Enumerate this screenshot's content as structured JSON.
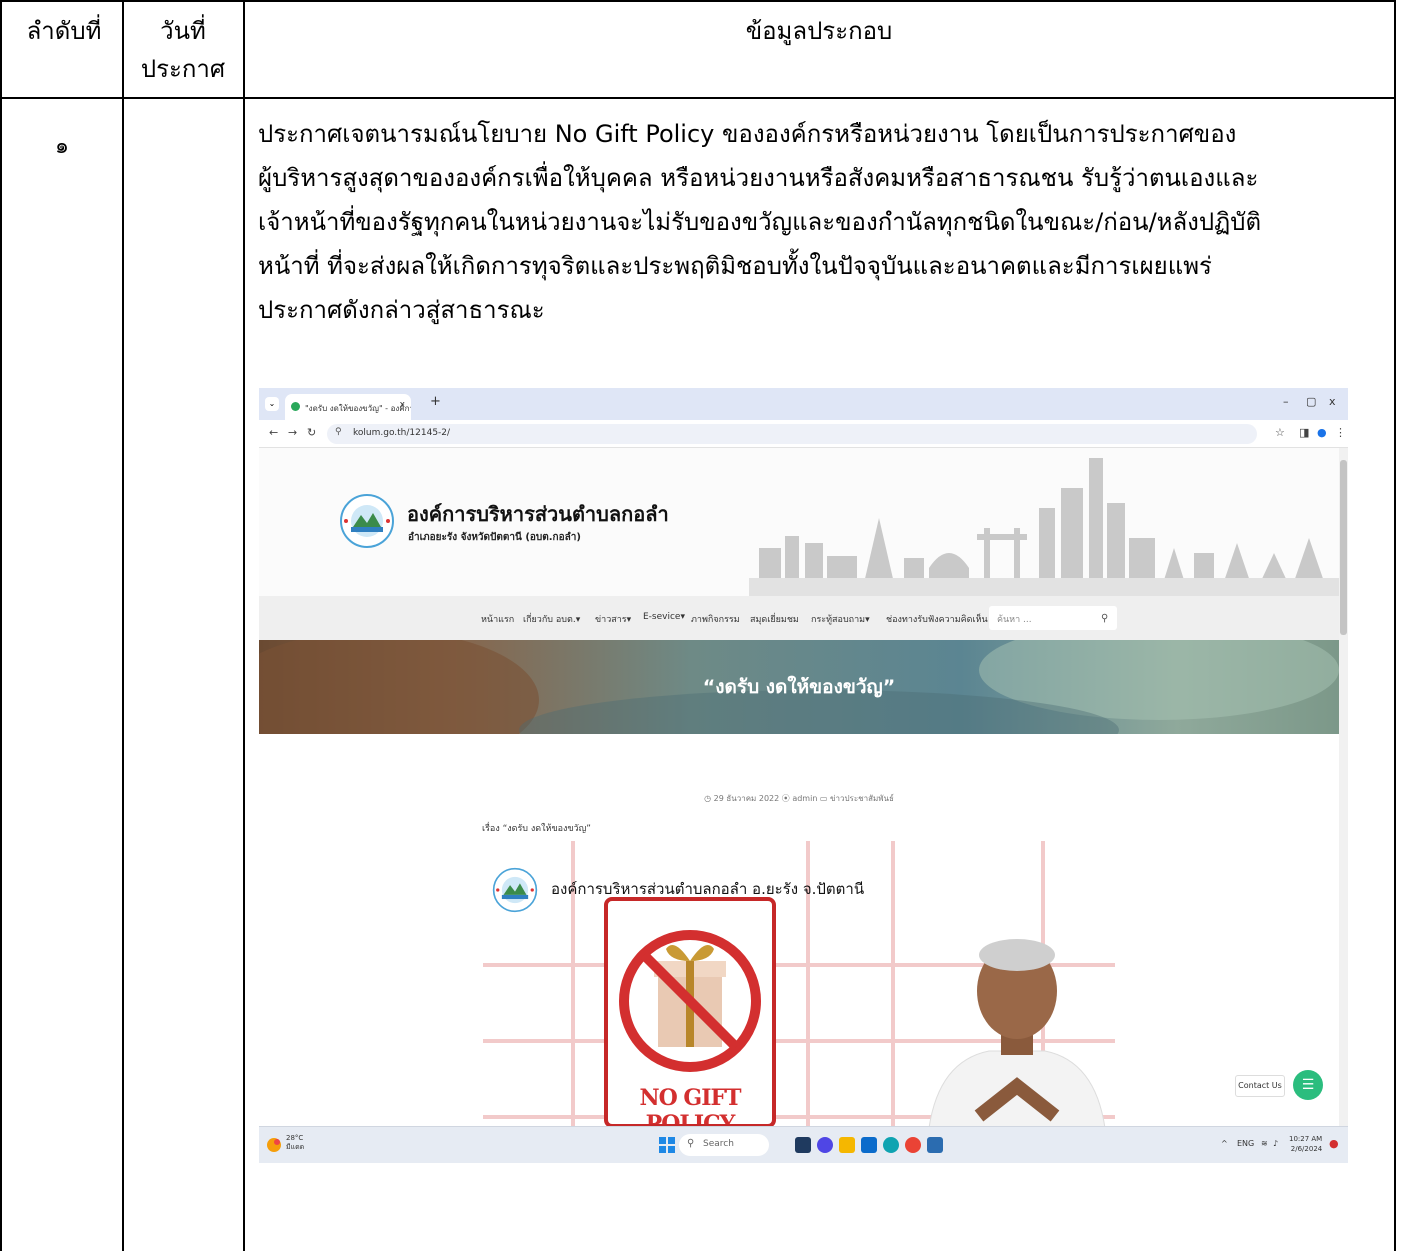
{
  "table": {
    "headers": {
      "no": "ลำดับที่",
      "date_line1": "วันที่",
      "date_line2": "ประกาศ",
      "info": "ข้อมูลประกอบ"
    },
    "row": {
      "no": "๑",
      "date": "",
      "description_lines": [
        "ประกาศเจตนารมณ์นโยบาย No Gift Policy ขององค์กรหรือหน่วยงาน โดยเป็นการประกาศของ",
        "ผู้บริหารสูงสุดาขององค์กรเพื่อให้บุคคล หรือหน่วยงานหรือสังคมหรือสาธารณชน รับรู้ว่าตนเองและ",
        "เจ้าหน้าที่ของรัฐทุกคนในหน่วยงานจะไม่รับของขวัญและของกำนัลทุกชนิดในขณะ/ก่อน/หลังปฏิบัติ",
        "หน้าที่ ที่จะส่งผลให้เกิดการทุจริตและประพฤติมิชอบทั้งในปัจจุบันและอนาคตและมีการเผยแพร่",
        "ประกาศดังกล่าวสู่สาธารณะ"
      ]
    }
  },
  "screenshot": {
    "browser": {
      "tab_title": "\"งดรับ งดให้ของขวัญ\" - องค์การบริห",
      "tab_close": "x",
      "new_tab": "+",
      "url": "kolum.go.th/12145-2/",
      "window_controls": [
        "–",
        "▢",
        "x"
      ]
    },
    "site": {
      "org_name": "องค์การบริหารส่วนตำบลกอลำ",
      "org_subtitle": "อำเภอยะรัง จังหวัดปัตตานี (อบต.กอลำ)",
      "menu": [
        "หน้าแรก",
        "เกี่ยวกับ อบต.▾",
        "ข่าวสาร▾",
        "E-sevice▾",
        "ภาพกิจกรรม",
        "สมุดเยี่ยมชม",
        "กระทู้สอบถาม▾",
        "ช่องทางรับฟังความคิดเห็น"
      ],
      "search_placeholder": "ค้นหา ...",
      "banner_title": "“งดรับ งดให้ของขวัญ”",
      "post_meta": "◷ 29 ธันวาคม 2022  ⦿ admin  ▭ ข่าวประชาสัมพันธ์",
      "post_subject": "เรื่อง “งดรับ งดให้ของขวัญ”",
      "poster_title": "องค์การบริหารส่วนตำบลกอลำ อ.ยะรัง  จ.ปัตตานี",
      "poster_badge": "NO GIFT POLICY",
      "contact_label": "Contact Us"
    },
    "taskbar": {
      "temp": "28°C",
      "weather": "มีแดด",
      "search": "Search",
      "lang": "ENG",
      "time": "10:27 AM",
      "date": "2/6/2024"
    }
  },
  "colors": {
    "accent_green": "#2bbd7e",
    "badge_red": "#d32f2f",
    "taskbar": "#e6ebf3"
  }
}
